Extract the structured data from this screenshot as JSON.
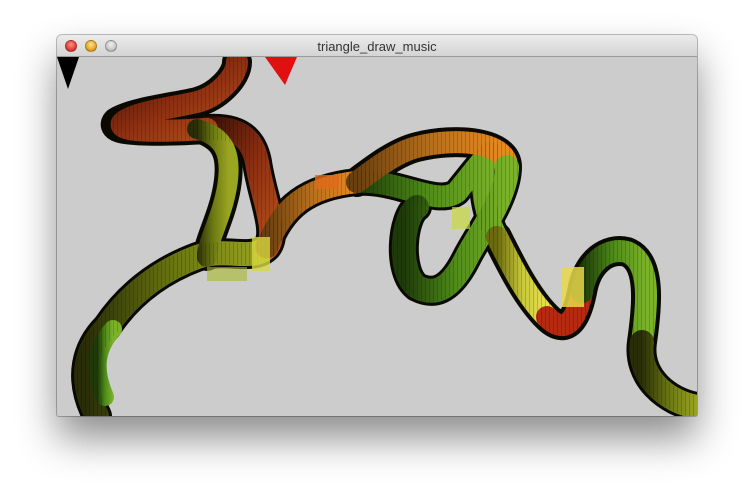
{
  "window": {
    "title": "triangle_draw_music",
    "buttons": [
      "close",
      "minimize",
      "zoom"
    ]
  },
  "canvas": {
    "background": "#cccccc",
    "palette": [
      "#1a1a06",
      "#6a7a10",
      "#8fb81c",
      "#c7d93a",
      "#e8d84a",
      "#b8421a",
      "#e06a1a",
      "#d01010",
      "#000000"
    ]
  }
}
